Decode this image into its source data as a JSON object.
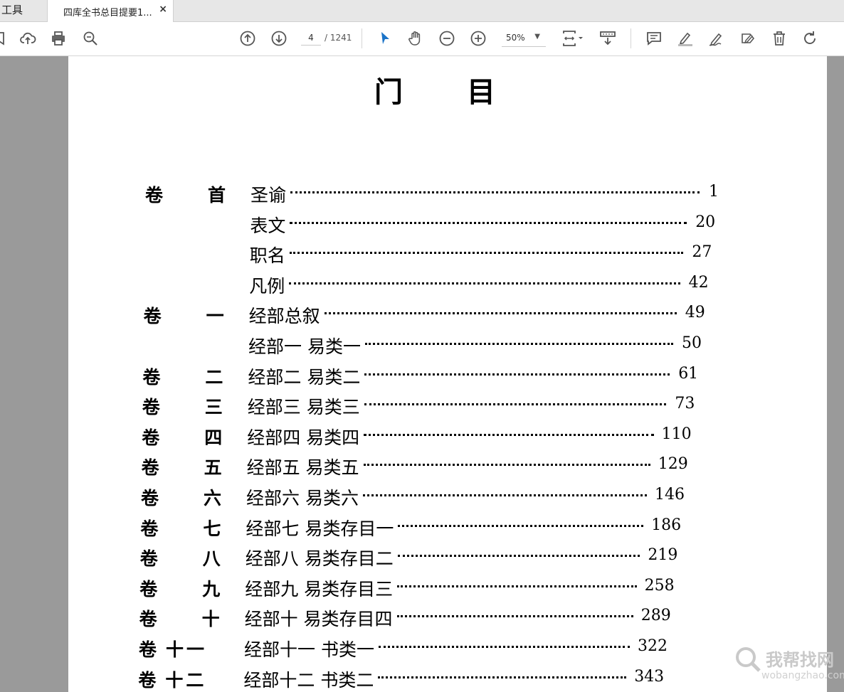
{
  "tabs": {
    "tools_label": "工具",
    "doc_title": "四库全书总目提要1...",
    "close_glyph": "×"
  },
  "toolbar": {
    "page_current": "4",
    "page_total": "/ 1241",
    "zoom": "50%",
    "icons": [
      "bookmark-icon",
      "upload-cloud-icon",
      "print-icon",
      "search-zoom-icon",
      "prev-page-icon",
      "next-page-icon",
      "select-arrow-icon",
      "hand-pan-icon",
      "zoom-out-icon",
      "zoom-in-icon",
      "fit-page-icon",
      "scroll-mode-icon",
      "comment-icon",
      "highlight-icon",
      "draw-icon",
      "sign-icon",
      "delete-icon",
      "rotate-icon"
    ]
  },
  "document": {
    "heading_left": "门",
    "heading_right": "目",
    "toc": [
      {
        "vol": "卷",
        "num": "首",
        "entry": "圣谕",
        "page": "1"
      },
      {
        "vol": "",
        "num": "",
        "entry": "表文",
        "page": "20"
      },
      {
        "vol": "",
        "num": "",
        "entry": "职名",
        "page": "27"
      },
      {
        "vol": "",
        "num": "",
        "entry": "凡例",
        "page": "42"
      },
      {
        "vol": "卷",
        "num": "一",
        "entry": "经部总叙",
        "page": "49"
      },
      {
        "vol": "",
        "num": "",
        "entry": "经部一 易类一",
        "page": "50"
      },
      {
        "vol": "卷",
        "num": "二",
        "entry": "经部二 易类二",
        "page": "61"
      },
      {
        "vol": "卷",
        "num": "三",
        "entry": "经部三 易类三",
        "page": "73"
      },
      {
        "vol": "卷",
        "num": "四",
        "entry": "经部四 易类四",
        "page": "110"
      },
      {
        "vol": "卷",
        "num": "五",
        "entry": "经部五 易类五",
        "page": "129"
      },
      {
        "vol": "卷",
        "num": "六",
        "entry": "经部六 易类六",
        "page": "146"
      },
      {
        "vol": "卷",
        "num": "七",
        "entry": "经部七 易类存目一",
        "page": "186"
      },
      {
        "vol": "卷",
        "num": "八",
        "entry": "经部八 易类存目二",
        "page": "219"
      },
      {
        "vol": "卷",
        "num": "九",
        "entry": "经部九 易类存目三",
        "page": "258"
      },
      {
        "vol": "卷",
        "num": "十",
        "entry": "经部十 易类存目四",
        "page": "289"
      },
      {
        "vol": "卷",
        "num": "十一",
        "entry": "经部十一 书类一",
        "page": "322"
      },
      {
        "vol": "卷",
        "num": "十二",
        "entry": "经部十二 书类二",
        "page": "343"
      }
    ]
  },
  "watermark": {
    "text_cn": "我帮找网",
    "text_en": "wobangzhao.com"
  }
}
